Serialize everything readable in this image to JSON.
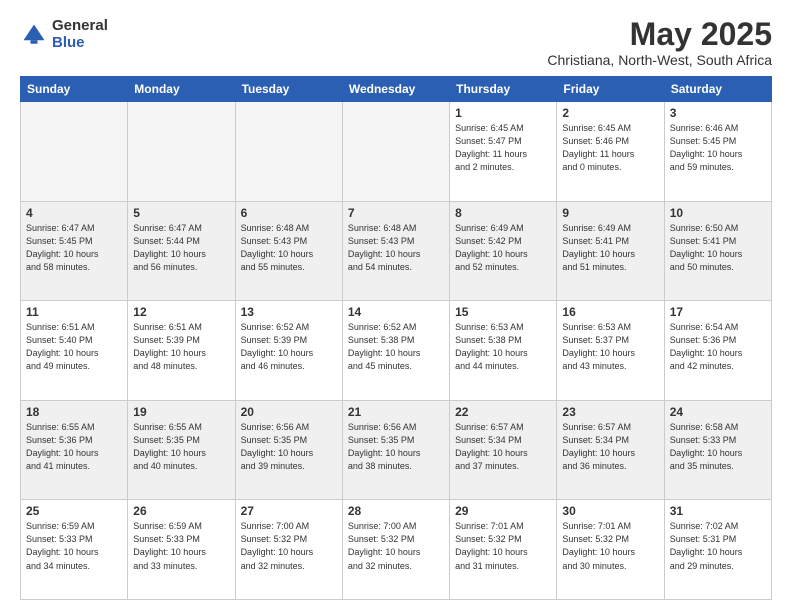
{
  "header": {
    "logo_general": "General",
    "logo_blue": "Blue",
    "title": "May 2025",
    "location": "Christiana, North-West, South Africa"
  },
  "weekdays": [
    "Sunday",
    "Monday",
    "Tuesday",
    "Wednesday",
    "Thursday",
    "Friday",
    "Saturday"
  ],
  "rows": [
    {
      "style": "white",
      "cells": [
        {
          "empty": true
        },
        {
          "empty": true
        },
        {
          "empty": true
        },
        {
          "empty": true
        },
        {
          "day": "1",
          "info": "Sunrise: 6:45 AM\nSunset: 5:47 PM\nDaylight: 11 hours\nand 2 minutes."
        },
        {
          "day": "2",
          "info": "Sunrise: 6:45 AM\nSunset: 5:46 PM\nDaylight: 11 hours\nand 0 minutes."
        },
        {
          "day": "3",
          "info": "Sunrise: 6:46 AM\nSunset: 5:45 PM\nDaylight: 10 hours\nand 59 minutes."
        }
      ]
    },
    {
      "style": "gray",
      "cells": [
        {
          "day": "4",
          "info": "Sunrise: 6:47 AM\nSunset: 5:45 PM\nDaylight: 10 hours\nand 58 minutes."
        },
        {
          "day": "5",
          "info": "Sunrise: 6:47 AM\nSunset: 5:44 PM\nDaylight: 10 hours\nand 56 minutes."
        },
        {
          "day": "6",
          "info": "Sunrise: 6:48 AM\nSunset: 5:43 PM\nDaylight: 10 hours\nand 55 minutes."
        },
        {
          "day": "7",
          "info": "Sunrise: 6:48 AM\nSunset: 5:43 PM\nDaylight: 10 hours\nand 54 minutes."
        },
        {
          "day": "8",
          "info": "Sunrise: 6:49 AM\nSunset: 5:42 PM\nDaylight: 10 hours\nand 52 minutes."
        },
        {
          "day": "9",
          "info": "Sunrise: 6:49 AM\nSunset: 5:41 PM\nDaylight: 10 hours\nand 51 minutes."
        },
        {
          "day": "10",
          "info": "Sunrise: 6:50 AM\nSunset: 5:41 PM\nDaylight: 10 hours\nand 50 minutes."
        }
      ]
    },
    {
      "style": "white",
      "cells": [
        {
          "day": "11",
          "info": "Sunrise: 6:51 AM\nSunset: 5:40 PM\nDaylight: 10 hours\nand 49 minutes."
        },
        {
          "day": "12",
          "info": "Sunrise: 6:51 AM\nSunset: 5:39 PM\nDaylight: 10 hours\nand 48 minutes."
        },
        {
          "day": "13",
          "info": "Sunrise: 6:52 AM\nSunset: 5:39 PM\nDaylight: 10 hours\nand 46 minutes."
        },
        {
          "day": "14",
          "info": "Sunrise: 6:52 AM\nSunset: 5:38 PM\nDaylight: 10 hours\nand 45 minutes."
        },
        {
          "day": "15",
          "info": "Sunrise: 6:53 AM\nSunset: 5:38 PM\nDaylight: 10 hours\nand 44 minutes."
        },
        {
          "day": "16",
          "info": "Sunrise: 6:53 AM\nSunset: 5:37 PM\nDaylight: 10 hours\nand 43 minutes."
        },
        {
          "day": "17",
          "info": "Sunrise: 6:54 AM\nSunset: 5:36 PM\nDaylight: 10 hours\nand 42 minutes."
        }
      ]
    },
    {
      "style": "gray",
      "cells": [
        {
          "day": "18",
          "info": "Sunrise: 6:55 AM\nSunset: 5:36 PM\nDaylight: 10 hours\nand 41 minutes."
        },
        {
          "day": "19",
          "info": "Sunrise: 6:55 AM\nSunset: 5:35 PM\nDaylight: 10 hours\nand 40 minutes."
        },
        {
          "day": "20",
          "info": "Sunrise: 6:56 AM\nSunset: 5:35 PM\nDaylight: 10 hours\nand 39 minutes."
        },
        {
          "day": "21",
          "info": "Sunrise: 6:56 AM\nSunset: 5:35 PM\nDaylight: 10 hours\nand 38 minutes."
        },
        {
          "day": "22",
          "info": "Sunrise: 6:57 AM\nSunset: 5:34 PM\nDaylight: 10 hours\nand 37 minutes."
        },
        {
          "day": "23",
          "info": "Sunrise: 6:57 AM\nSunset: 5:34 PM\nDaylight: 10 hours\nand 36 minutes."
        },
        {
          "day": "24",
          "info": "Sunrise: 6:58 AM\nSunset: 5:33 PM\nDaylight: 10 hours\nand 35 minutes."
        }
      ]
    },
    {
      "style": "white",
      "cells": [
        {
          "day": "25",
          "info": "Sunrise: 6:59 AM\nSunset: 5:33 PM\nDaylight: 10 hours\nand 34 minutes."
        },
        {
          "day": "26",
          "info": "Sunrise: 6:59 AM\nSunset: 5:33 PM\nDaylight: 10 hours\nand 33 minutes."
        },
        {
          "day": "27",
          "info": "Sunrise: 7:00 AM\nSunset: 5:32 PM\nDaylight: 10 hours\nand 32 minutes."
        },
        {
          "day": "28",
          "info": "Sunrise: 7:00 AM\nSunset: 5:32 PM\nDaylight: 10 hours\nand 32 minutes."
        },
        {
          "day": "29",
          "info": "Sunrise: 7:01 AM\nSunset: 5:32 PM\nDaylight: 10 hours\nand 31 minutes."
        },
        {
          "day": "30",
          "info": "Sunrise: 7:01 AM\nSunset: 5:32 PM\nDaylight: 10 hours\nand 30 minutes."
        },
        {
          "day": "31",
          "info": "Sunrise: 7:02 AM\nSunset: 5:31 PM\nDaylight: 10 hours\nand 29 minutes."
        }
      ]
    }
  ]
}
